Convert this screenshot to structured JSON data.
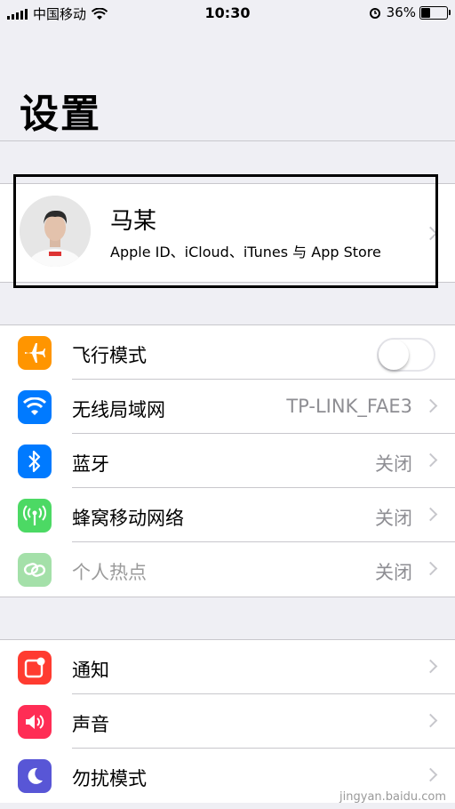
{
  "status_bar": {
    "carrier": "中国移动",
    "time": "10:30",
    "battery_percent": "36%",
    "battery_level": 0.36
  },
  "page": {
    "title": "设置"
  },
  "profile": {
    "name": "马某",
    "subtitle": "Apple ID、iCloud、iTunes 与 App Store"
  },
  "connectivity": [
    {
      "label": "飞行模式",
      "icon": "airplane-icon",
      "color": "#ff9500",
      "toggle": false
    },
    {
      "label": "无线局域网",
      "value": "TP-LINK_FAE3",
      "icon": "wifi-icon",
      "color": "#007aff"
    },
    {
      "label": "蓝牙",
      "value": "关闭",
      "icon": "bluetooth-icon",
      "color": "#007aff"
    },
    {
      "label": "蜂窝移动网络",
      "value": "关闭",
      "icon": "cellular-icon",
      "color": "#4cd964"
    },
    {
      "label": "个人热点",
      "value": "关闭",
      "icon": "hotspot-icon",
      "color": "#a4e0a9",
      "disabled": true
    }
  ],
  "notifications": [
    {
      "label": "通知",
      "icon": "notifications-icon",
      "color": "#ff3b30"
    },
    {
      "label": "声音",
      "icon": "sound-icon",
      "color": "#ff2d55"
    },
    {
      "label": "勿扰模式",
      "icon": "moon-icon",
      "color": "#5856d6"
    }
  ],
  "watermark": {
    "text": "jingyan.baidu.com"
  }
}
